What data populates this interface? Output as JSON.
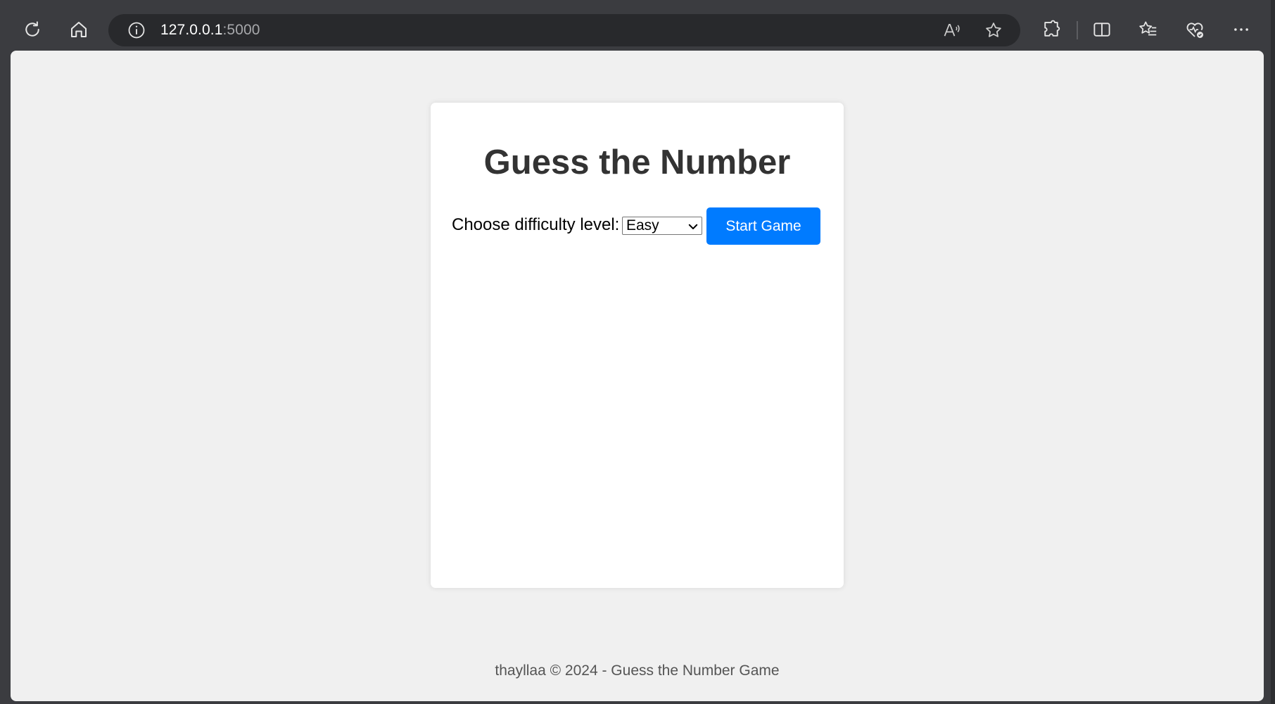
{
  "browser": {
    "url_host": "127.0.0.1",
    "url_port": ":5000",
    "icons": [
      "refresh-icon",
      "home-icon",
      "info-icon",
      "read-aloud-icon",
      "favorite-star-icon",
      "extensions-icon",
      "split-screen-icon",
      "favorites-icon",
      "browser-essentials-icon",
      "more-icon"
    ]
  },
  "page": {
    "title": "Guess the Number",
    "difficulty_label": "Choose difficulty level:",
    "difficulty_selected": "Easy",
    "start_button": "Start Game",
    "footer": "thayllaa © 2024 - Guess the Number Game",
    "colors": {
      "background": "#f0f0f0",
      "card": "#ffffff",
      "button": "#007bff",
      "title": "#333333"
    }
  }
}
